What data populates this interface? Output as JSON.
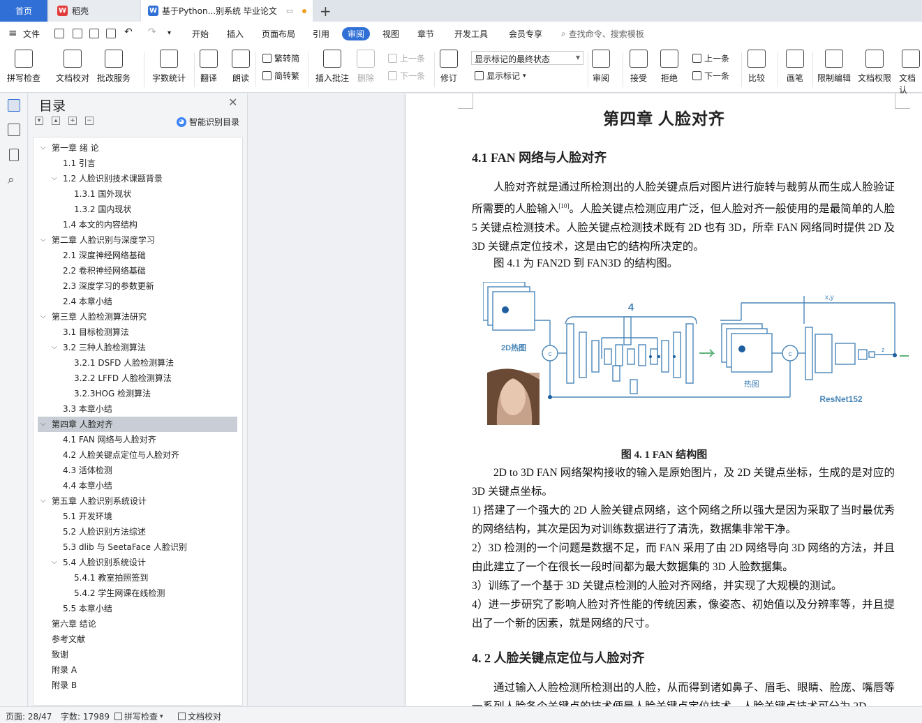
{
  "tabs": {
    "home": "首页",
    "daoke": "稻壳",
    "document": "基于Python...别系统 毕业论文"
  },
  "menu": {
    "file": "文件",
    "items": [
      "开始",
      "插入",
      "页面布局",
      "引用",
      "审阅",
      "视图",
      "章节",
      "开发工具",
      "会员专享"
    ],
    "active": "审阅",
    "search_placeholder": "查找命令、搜索模板"
  },
  "ribbon": {
    "spell_check": "拼写检查",
    "doc_proof": "文档校对",
    "batch_service": "批改服务",
    "word_count": "字数统计",
    "translate": "翻译",
    "read_aloud": "朗读",
    "trad_to_simp_top": "繁转简",
    "simp_to_trad": "简转繁",
    "insert_comment": "插入批注",
    "delete": "删除",
    "prev": "上一条",
    "next": "下一条",
    "track_changes": "修订",
    "markup_state": "显示标记的最终状态",
    "show_markup": "显示标记",
    "review": "审阅",
    "accept": "接受",
    "reject": "拒绝",
    "prev2": "上一条",
    "next2": "下一条",
    "compare": "比较",
    "pen": "画笔",
    "restrict_edit": "限制编辑",
    "doc_permission": "文档权限",
    "doc_auth": "文档认"
  },
  "toc": {
    "title": "目录",
    "smart": "智能识别目录",
    "items": [
      {
        "label": "第一章  绪  论",
        "level": 0,
        "chev": "v"
      },
      {
        "label": "1.1  引言",
        "level": 1
      },
      {
        "label": "1.2  人脸识别技术课题背景",
        "level": 1,
        "chev": "v"
      },
      {
        "label": "1.3.1  国外现状",
        "level": 2
      },
      {
        "label": "1.3.2  国内现状",
        "level": 2
      },
      {
        "label": "1.4  本文的内容结构",
        "level": 1
      },
      {
        "label": "第二章  人脸识别与深度学习",
        "level": 0,
        "chev": "v"
      },
      {
        "label": "2.1 深度神经网络基础",
        "level": 1
      },
      {
        "label": "2.2 卷积神经网络基础",
        "level": 1
      },
      {
        "label": "2.3  深度学习的参数更新",
        "level": 1
      },
      {
        "label": "2.4 本章小结",
        "level": 1
      },
      {
        "label": "第三章  人脸检测算法研究",
        "level": 0,
        "chev": "v"
      },
      {
        "label": "3.1 目标检测算法",
        "level": 1
      },
      {
        "label": "3.2 三种人脸检测算法",
        "level": 1,
        "chev": "v"
      },
      {
        "label": "3.2.1 DSFD 人脸检测算法",
        "level": 2
      },
      {
        "label": "3.2.2 LFFD 人脸检测算法",
        "level": 2
      },
      {
        "label": "3.2.3HOG 检测算法",
        "level": 2
      },
      {
        "label": "3.3  本章小结",
        "level": 1
      },
      {
        "label": "第四章  人脸对齐",
        "level": 0,
        "chev": "v",
        "selected": true
      },
      {
        "label": "4.1 FAN 网络与人脸对齐",
        "level": 1
      },
      {
        "label": "4.2 人脸关键点定位与人脸对齐",
        "level": 1
      },
      {
        "label": "4.3 活体检测",
        "level": 1
      },
      {
        "label": "4.4  本章小结",
        "level": 1
      },
      {
        "label": "第五章  人脸识别系统设计",
        "level": 0,
        "chev": "v"
      },
      {
        "label": "5.1  开发环境",
        "level": 1
      },
      {
        "label": "5.2 人脸识别方法综述",
        "level": 1
      },
      {
        "label": "5.3 dlib 与 SeetaFace 人脸识别",
        "level": 1
      },
      {
        "label": "5.4  人脸识别系统设计",
        "level": 1,
        "chev": "v"
      },
      {
        "label": "5.4.1  教室拍照签到",
        "level": 2
      },
      {
        "label": "5.4.2  学生网课在线检测",
        "level": 2
      },
      {
        "label": "5.5 本章小结",
        "level": 1
      },
      {
        "label": "第六章  结论",
        "level": 0
      },
      {
        "label": "参考文献",
        "level": 0
      },
      {
        "label": "致谢",
        "level": 0
      },
      {
        "label": "附录 A",
        "level": 0
      },
      {
        "label": "附录 B",
        "level": 0
      }
    ]
  },
  "doc": {
    "chapter_title": "第四章  人脸对齐",
    "sec1_title": "4.1  FAN 网络与人脸对齐",
    "p1": "人脸对齐就是通过所检测出的人脸关键点后对图片进行旋转与裁剪从而生成人脸验证所需要的人脸输入",
    "p1_ref": "[10]",
    "p1b": "。人脸关键点检测应用广泛，但人脸对齐一般使用的是最简单的人脸 5 关键点检测技术。人脸关键点检测技术既有 2D 也有 3D，所幸 FAN 网络同时提供 2D 及 3D 关键点定位技术，这是由它的结构所决定的。",
    "p2": "图 4.1 为 FAN2D 到 FAN3D 的结构图。",
    "figure": {
      "label_4": "4",
      "label_xy": "x,y",
      "label_z": "z",
      "label_2d_heatmap": "2D热图",
      "label_heatmap": "热图",
      "label_resnet": "ResNet152",
      "label_c": "c"
    },
    "fig_caption": "图 4. 1 FAN 结构图",
    "p3": "2D to 3D FAN 网络架构接收的输入是原始图片，及 2D 关键点坐标，生成的是对应的 3D 关键点坐标。",
    "p4": "1) 搭建了一个强大的 2D 人脸关键点网络，这个网络之所以强大是因为采取了当时最优秀的网络结构，其次是因为对训练数据进行了清洗，数据集非常干净。",
    "p5": "2）3D 检测的一个问题是数据不足，而 FAN 采用了由 2D 网络导向 3D 网络的方法，并且由此建立了一个在很长一段时间都为最大数据集的 3D 人脸数据集。",
    "p6": "3）训练了一个基于 3D 关键点检测的人脸对齐网络，并实现了大规模的测试。",
    "p7": "4）进一步研究了影响人脸对齐性能的传统因素，像姿态、初始值以及分辨率等，并且提出了一个新的因素，就是网络的尺寸。",
    "sec2_title": "4. 2  人脸关键点定位与人脸对齐",
    "p8": "通过输入人脸检测所检测出的人脸，从而得到诸如鼻子、眉毛、眼睛、脸庞、嘴唇等一系列人脸各个关键点的技术便是人脸关键点定位技术。人脸关键点技术可分为 2D"
  },
  "status": {
    "page": "页面: 28/47",
    "words": "字数: 17989",
    "spell": "拼写检查",
    "proof": "文档校对"
  },
  "colors": {
    "accent": "#2f6fd6",
    "figure_blue": "#4a86b8"
  }
}
